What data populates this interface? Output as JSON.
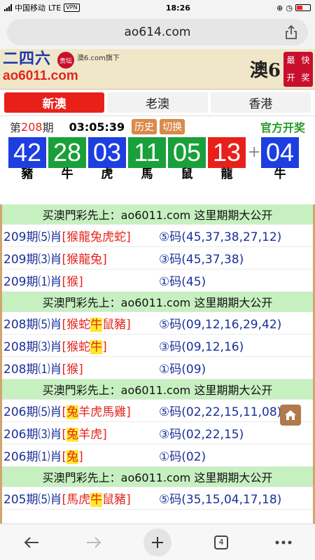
{
  "status": {
    "carrier": "中国移动",
    "network": "LTE",
    "vpn": "VPN",
    "time": "18:26"
  },
  "browser": {
    "url": "ao614.com"
  },
  "banner": {
    "brand": "二四六",
    "seal": "贵坛",
    "sub": "澳6.com旗下",
    "domain": "ao6011.com",
    "logo": "澳6",
    "stamp": [
      "最",
      "快",
      "开",
      "奖"
    ]
  },
  "tabs": [
    {
      "label": "新澳",
      "active": true
    },
    {
      "label": "老澳",
      "active": false
    },
    {
      "label": "香港",
      "active": false
    }
  ],
  "draw": {
    "prefix": "第",
    "number": "208",
    "suffix": "期",
    "countdown": "03:05:39",
    "history_btn": "历史",
    "switch_btn": "切换",
    "official": "官方开奖"
  },
  "balls": [
    {
      "num": "42",
      "zodiac": "豬",
      "color": "blue"
    },
    {
      "num": "28",
      "zodiac": "牛",
      "color": "green"
    },
    {
      "num": "03",
      "zodiac": "虎",
      "color": "blue"
    },
    {
      "num": "11",
      "zodiac": "馬",
      "color": "green"
    },
    {
      "num": "05",
      "zodiac": "鼠",
      "color": "green"
    },
    {
      "num": "13",
      "zodiac": "龍",
      "color": "red"
    }
  ],
  "plus": "+",
  "special": {
    "num": "04",
    "zodiac": "牛",
    "color": "blue"
  },
  "promo": "买澳門彩先上：ao6011.com 这里期期大公开",
  "groups": [
    {
      "rows": [
        {
          "prefix": "209期⑸肖",
          "picks": [
            "[",
            "猴",
            "龍",
            "兔",
            "虎",
            "蛇",
            "]"
          ],
          "hl": [],
          "code": "⑤码(45,37,38,27,12)"
        },
        {
          "prefix": "209期⑶肖",
          "picks": [
            "[",
            "猴",
            "龍",
            "兔",
            "]"
          ],
          "hl": [],
          "code": "③码(45,37,38)"
        },
        {
          "prefix": "209期⑴肖",
          "picks": [
            "[",
            "猴",
            "]"
          ],
          "hl": [],
          "code": "①码(45)"
        }
      ]
    },
    {
      "rows": [
        {
          "prefix": "208期⑸肖",
          "picks": [
            "[",
            "猴",
            "蛇",
            "牛",
            "鼠",
            "豬",
            "]"
          ],
          "hl": [
            3
          ],
          "code": "⑤码(09,12,16,29,42)"
        },
        {
          "prefix": "208期⑶肖",
          "picks": [
            "[",
            "猴",
            "蛇",
            "牛",
            "]"
          ],
          "hl": [
            3
          ],
          "code": "③码(09,12,16)"
        },
        {
          "prefix": "208期⑴肖",
          "picks": [
            "[",
            "猴",
            "]"
          ],
          "hl": [],
          "code": "①码(09)"
        }
      ]
    },
    {
      "rows": [
        {
          "prefix": "206期⑸肖",
          "picks": [
            "[",
            "兔",
            "羊",
            "虎",
            "馬",
            "雞",
            "]"
          ],
          "hl": [
            1
          ],
          "code": "⑤码(02,22,15,11,08)"
        },
        {
          "prefix": "206期⑶肖",
          "picks": [
            "[",
            "兔",
            "羊",
            "虎",
            "]"
          ],
          "hl": [
            1
          ],
          "code": "③码(02,22,15)"
        },
        {
          "prefix": "206期⑴肖",
          "picks": [
            "[",
            "兔",
            "]"
          ],
          "hl": [
            1
          ],
          "code": "①码(02)"
        }
      ]
    },
    {
      "rows": [
        {
          "prefix": "205期⑸肖",
          "picks": [
            "[",
            "馬",
            "虎",
            "牛",
            "鼠",
            "豬",
            "]"
          ],
          "hl": [
            3
          ],
          "code": "⑤码(35,15,04,17,18)"
        }
      ]
    }
  ],
  "nav": {
    "tab_count": "4"
  }
}
